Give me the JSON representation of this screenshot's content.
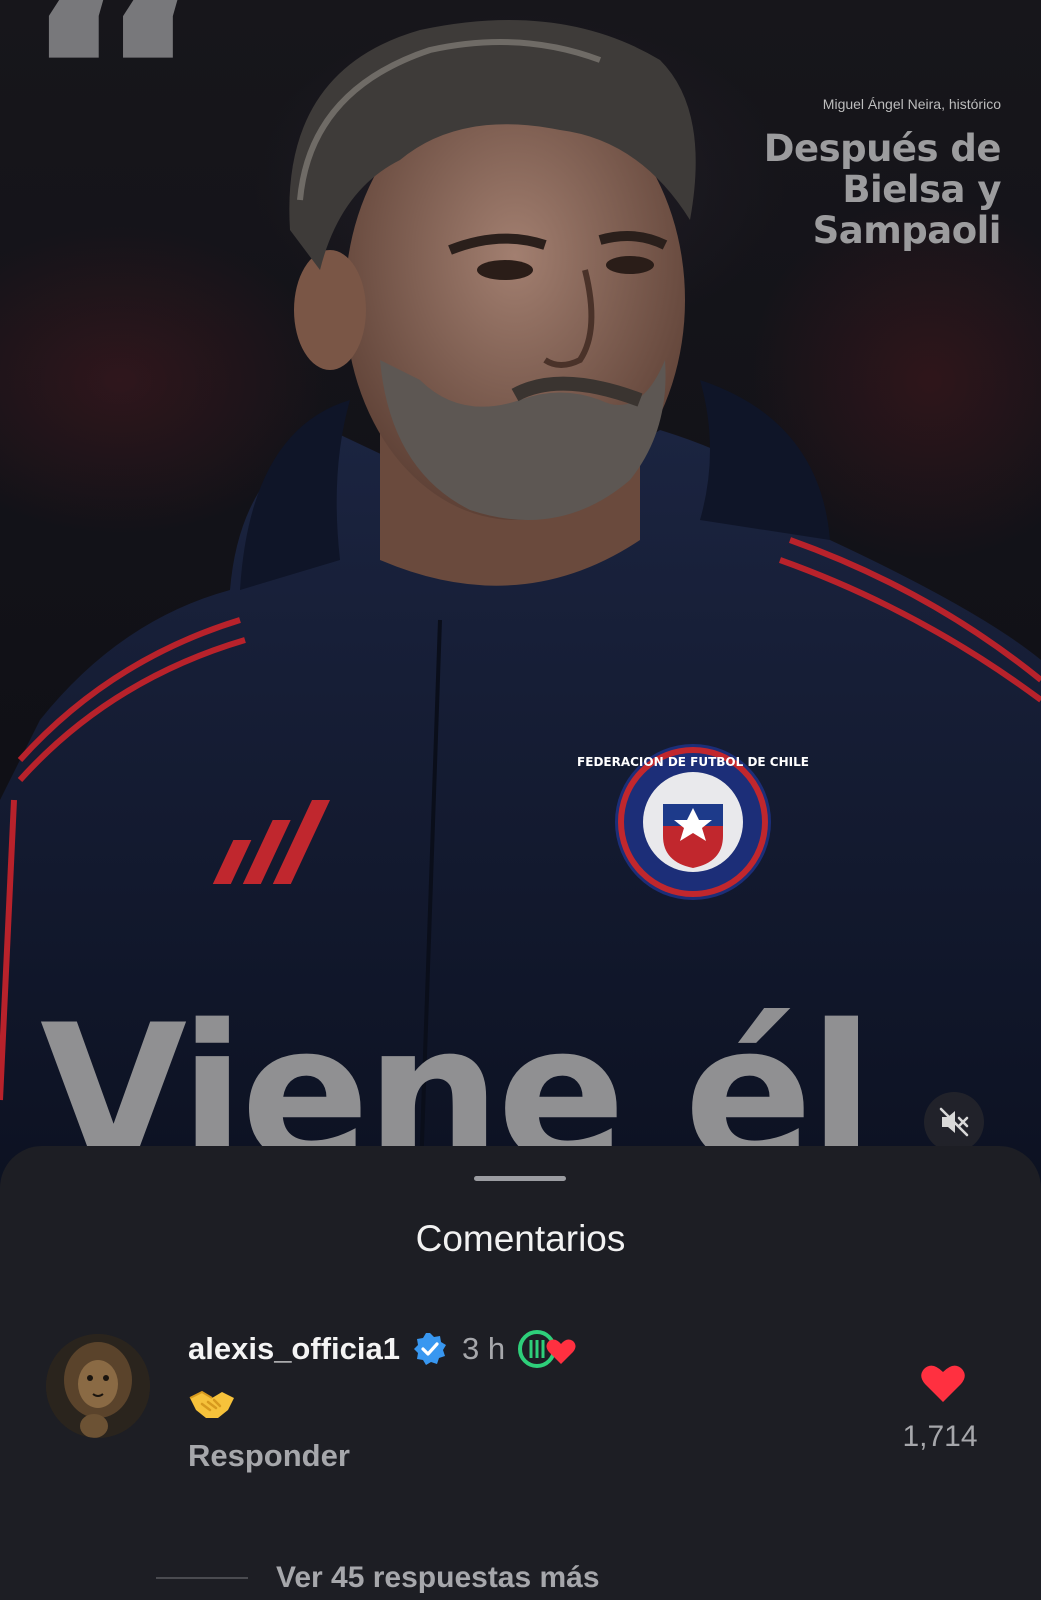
{
  "post": {
    "attribution": "Miguel Ángel Neira, histórico",
    "headline": "Después de Bielsa y Sampaoli",
    "big_text": "Viene él",
    "quote_glyph": "“",
    "badge_text": "FEDERACION DE FUTBOL DE CHILE",
    "mute_icon": "speaker-muted-icon"
  },
  "comments_sheet": {
    "title": "Comentarios",
    "comments": [
      {
        "username": "alexis_officia1",
        "verified": true,
        "time": "3 h",
        "badge_icon": "heart-logo-badge-icon",
        "body_emoji": "handshake",
        "reply_label": "Responder",
        "like_count": "1,714",
        "liked": true,
        "view_replies": "Ver 45 respuestas más"
      }
    ]
  },
  "colors": {
    "sheet_bg": "#1d1e24",
    "like_red": "#ff3040",
    "verified_blue": "#3897f0",
    "jacket_navy": "#121a30",
    "jacket_stripe": "#b8222b"
  }
}
